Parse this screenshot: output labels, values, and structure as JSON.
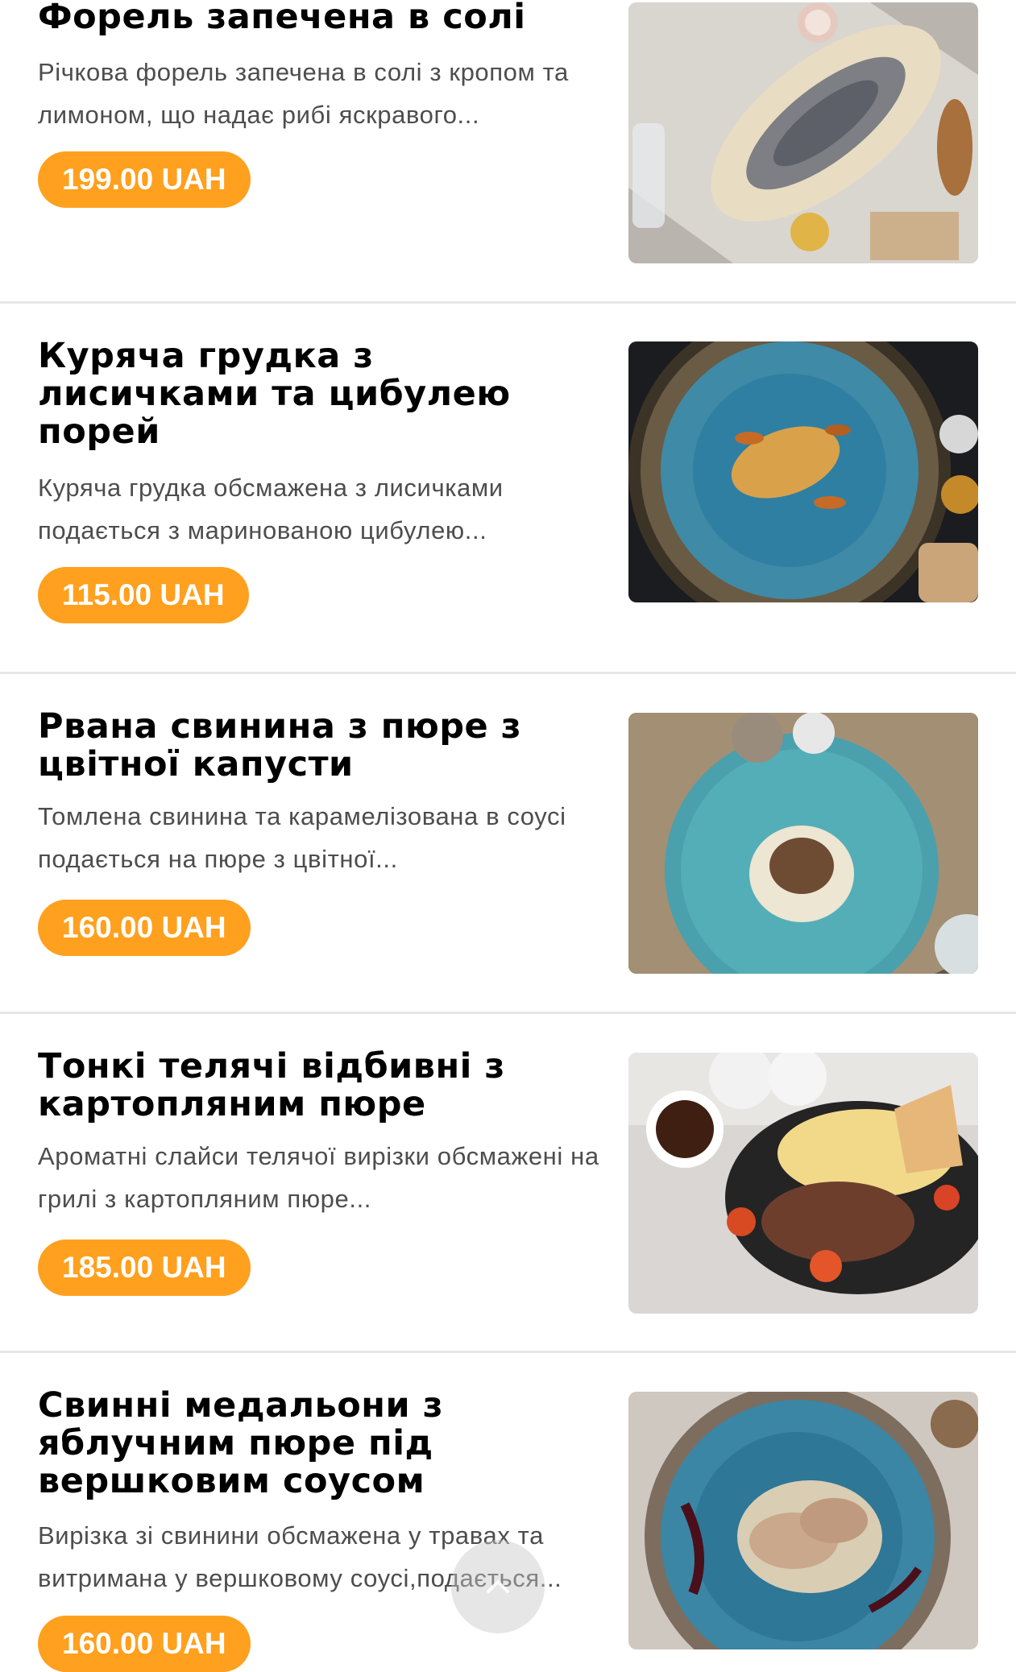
{
  "menu": {
    "items": [
      {
        "title": "Форель запечена в солі",
        "description": "Річкова форель запечена в солі з кропом та лимоном, що надає рибі яскравого...",
        "price": "199.00 UAH",
        "photo": "salt-baked-trout-photo"
      },
      {
        "title": "Куряча грудка з лисичками та цибулею порей",
        "description": "Куряча грудка обсмажена з лисичками подається з маринованою цибулею...",
        "price": "115.00 UAH",
        "photo": "chicken-chanterelles-photo"
      },
      {
        "title": "Рвана свинина з пюре з цвітної капусти",
        "description": "Томлена свинина та карамелізована в соусі подається на пюре з цвітної...",
        "price": "160.00 UAH",
        "photo": "pulled-pork-photo"
      },
      {
        "title": "Тонкі телячі відбивні з картопляним пюре",
        "description": "Ароматні слайси телячої вирізки обсмажені на грилі з картопляним пюре...",
        "price": "185.00 UAH",
        "photo": "veal-chops-photo"
      },
      {
        "title": "Свинні медальони з яблучним пюре під вершковим соусом",
        "description": "Вирізка зі свинини обсмажена у травах та витримана у вершковому соусі,подається...",
        "price": "160.00 UAH",
        "photo": "pork-medallions-photo"
      }
    ]
  },
  "colors": {
    "accent": "#ffa01e",
    "title": "#000000",
    "description": "#4d4d4d",
    "divider": "#e6e6e6"
  },
  "icons": {
    "scroll_top": "chevron-up-icon"
  }
}
